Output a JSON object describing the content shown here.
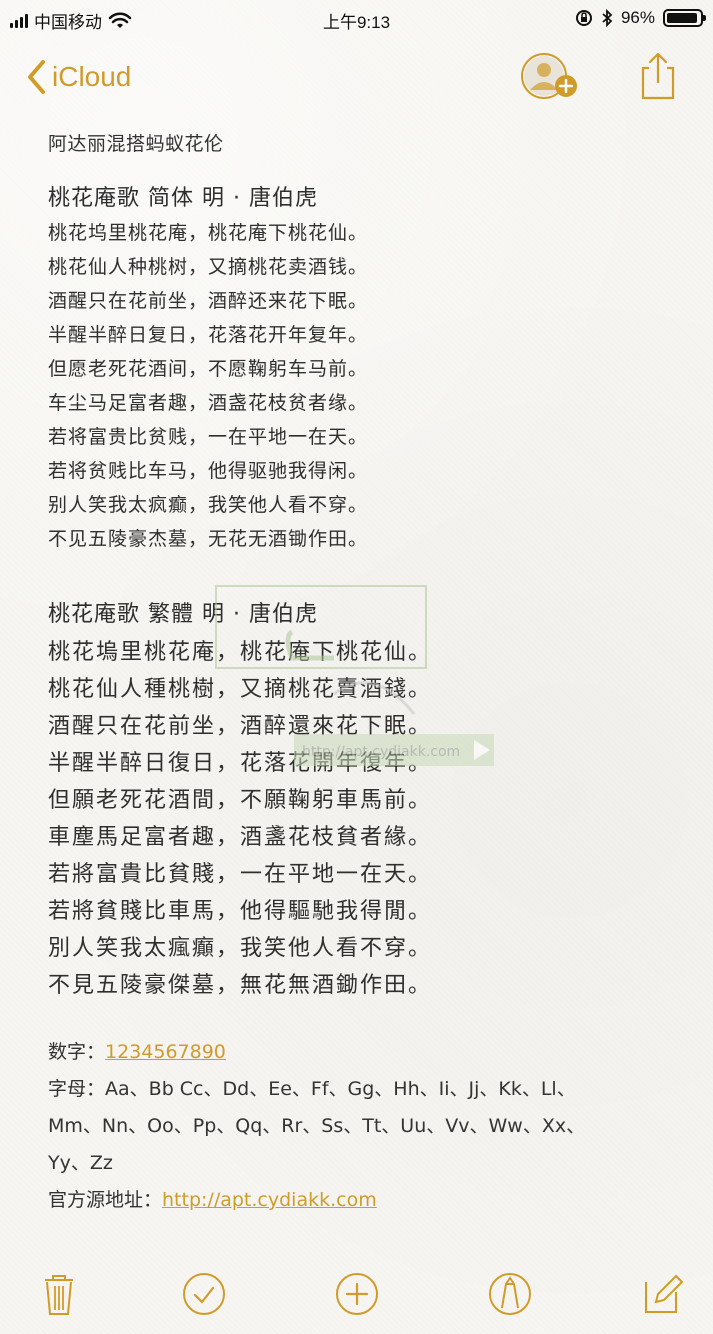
{
  "status_bar": {
    "carrier": "中国移动",
    "time": "上午9:13",
    "battery": "96%",
    "icons": [
      "signal-icon",
      "wifi-icon",
      "orientation-lock-icon",
      "bluetooth-icon",
      "battery-icon"
    ]
  },
  "nav": {
    "back_label": "iCloud",
    "icons": [
      "chevron-left-icon",
      "add-person-icon",
      "share-icon"
    ]
  },
  "note": {
    "title": "阿达丽混搭蚂蚁花伦",
    "simplified": {
      "title": "桃花庵歌  简体 明 · 唐伯虎",
      "lines": [
        "桃花坞里桃花庵，桃花庵下桃花仙。",
        "桃花仙人种桃树，又摘桃花卖酒钱。",
        "酒醒只在花前坐，酒醉还来花下眠。",
        "半醒半醉日复日，花落花开年复年。",
        "但愿老死花酒间，不愿鞠躬车马前。",
        "车尘马足富者趣，酒盏花枝贫者缘。",
        "若将富贵比贫贱，一在平地一在天。",
        "若将贫贱比车马，他得驱驰我得闲。",
        "别人笑我太疯癫，我笑他人看不穿。",
        "不见五陵豪杰墓，无花无酒锄作田。"
      ]
    },
    "traditional": {
      "title": "桃花庵歌  繁體 明 · 唐伯虎",
      "lines": [
        "桃花塢里桃花庵，桃花庵下桃花仙。",
        "桃花仙人種桃樹，又摘桃花賣酒錢。",
        "酒醒只在花前坐，酒醉還來花下眠。",
        "半醒半醉日復日，花落花開年復年。",
        "但願老死花酒間，不願鞠躬車馬前。",
        "車塵馬足富者趣，酒盞花枝貧者緣。",
        "若將富貴比貧賤，一在平地一在天。",
        "若將貧賤比車馬，他得驅馳我得閒。",
        "別人笑我太瘋癲，我笑他人看不穿。",
        "不見五陵豪傑墓，無花無酒鋤作田。"
      ]
    },
    "digits_label": "数字：",
    "digits_value": "1234567890",
    "letters_label": "字母：",
    "letters_line_1": "Aa、Bb Cc、Dd、Ee、Ff、Gg、Hh、Ii、Jj、Kk、Ll、",
    "letters_line_2": "Mm、Nn、Oo、Pp、Qq、Rr、Ss、Tt、Uu、Vv、Ww、Xx、",
    "letters_line_3": "Yy、Zz",
    "source_label": "官方源地址：",
    "source_url": "http://apt.cydiakk.com"
  },
  "watermark": {
    "url": "http://apt.cydiakk.com"
  },
  "toolbar": {
    "icons": [
      "trash-icon",
      "checkmark-icon",
      "plus-icon",
      "markup-pen-icon",
      "compose-icon"
    ]
  },
  "colors": {
    "accent": "#d19b2a",
    "text": "#2f2f2f",
    "background": "#f6f5f1"
  }
}
